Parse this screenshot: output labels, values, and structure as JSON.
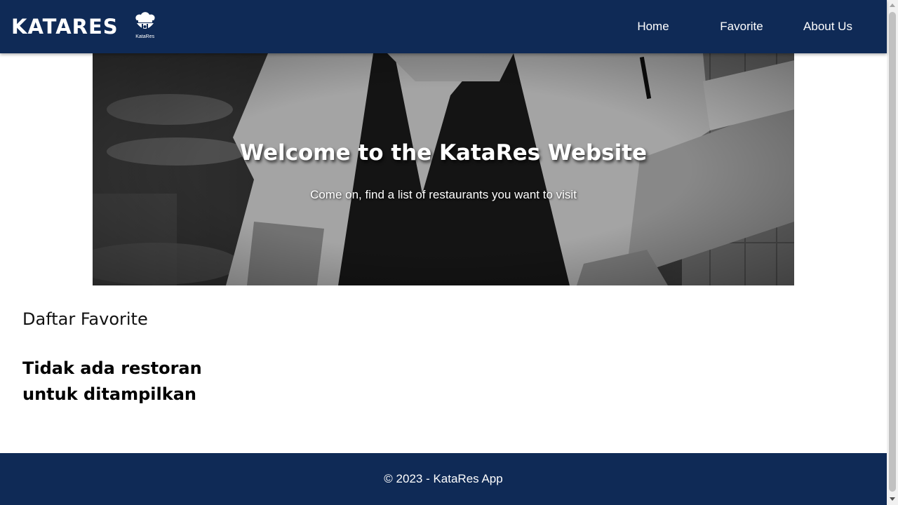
{
  "header": {
    "brand_title": "KATARES",
    "logo_caption": "KataRes",
    "nav": {
      "home": "Home",
      "favorite": "Favorite",
      "about": "About Us"
    },
    "background_color": "#0f2a56"
  },
  "hero": {
    "title": "Welcome to the KataRes Website",
    "subtitle": "Come on, find a list of restaurants you want to visit"
  },
  "main": {
    "section_heading": "Daftar Favorite",
    "empty_message": "Tidak ada restoran untuk ditampilkan"
  },
  "footer": {
    "text": "© 2023 - KataRes App"
  }
}
